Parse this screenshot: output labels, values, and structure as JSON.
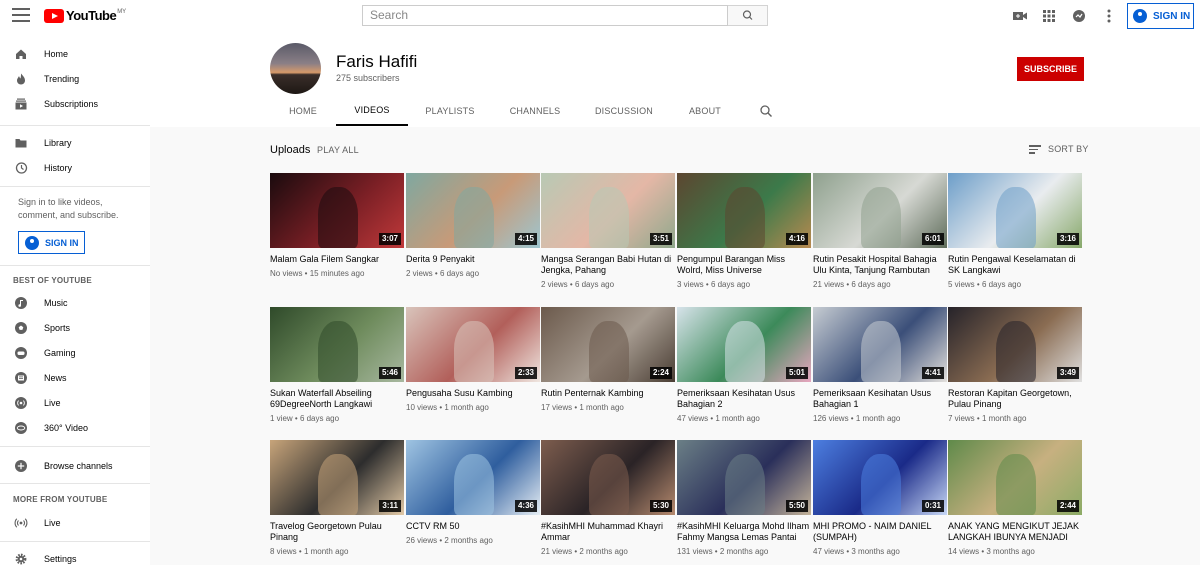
{
  "header": {
    "logo_text": "YouTube",
    "logo_country": "MY",
    "search_placeholder": "Search",
    "sign_in": "SIGN IN",
    "icons": [
      "menu-icon",
      "search-icon",
      "create-video-icon",
      "apps-icon",
      "messages-icon",
      "more-icon"
    ]
  },
  "sidebar": {
    "items_main": [
      {
        "label": "Home",
        "icon": "home-icon"
      },
      {
        "label": "Trending",
        "icon": "trending-icon"
      },
      {
        "label": "Subscriptions",
        "icon": "subscriptions-icon"
      }
    ],
    "items_library": [
      {
        "label": "Library",
        "icon": "library-icon"
      },
      {
        "label": "History",
        "icon": "history-icon"
      }
    ],
    "sign_in_text": "Sign in to like videos, comment, and subscribe.",
    "sign_in_button": "SIGN IN",
    "best_heading": "BEST OF YOUTUBE",
    "best_items": [
      {
        "label": "Music",
        "icon": "music-icon"
      },
      {
        "label": "Sports",
        "icon": "sports-icon"
      },
      {
        "label": "Gaming",
        "icon": "gaming-icon"
      },
      {
        "label": "News",
        "icon": "news-icon"
      },
      {
        "label": "Live",
        "icon": "live-icon"
      },
      {
        "label": "360° Video",
        "icon": "360-video-icon"
      }
    ],
    "browse_channels": "Browse channels",
    "more_heading": "MORE FROM YOUTUBE",
    "more_live": "Live",
    "settings": "Settings"
  },
  "channel": {
    "name": "Faris Hafifi",
    "subscribers": "275 subscribers",
    "subscribe_button": "SUBSCRIBE",
    "tabs": [
      "HOME",
      "VIDEOS",
      "PLAYLISTS",
      "CHANNELS",
      "DISCUSSION",
      "ABOUT"
    ],
    "active_tab": "VIDEOS"
  },
  "uploads": {
    "title": "Uploads",
    "play_all": "PLAY ALL",
    "sort_by": "SORT BY"
  },
  "videos": [
    {
      "title": "Malam Gala Filem Sangkar",
      "views": "No views",
      "age": "15 minutes ago",
      "duration": "3:07",
      "colors": [
        "#1a0b0e",
        "#7a1f25",
        "#c0393a"
      ]
    },
    {
      "title": "Derita 9 Penyakit",
      "views": "2 views",
      "age": "6 days ago",
      "duration": "4:15",
      "colors": [
        "#7fa8a0",
        "#c89a78",
        "#9dc6d0"
      ]
    },
    {
      "title": "Mangsa Serangan Babi Hutan di Jengka, Pahang",
      "views": "2 views",
      "age": "6 days ago",
      "duration": "3:51",
      "colors": [
        "#b8c9b4",
        "#e4b7a6",
        "#8fa88c"
      ]
    },
    {
      "title": "Pengumpul Barangan Miss Wolrd, Miss Universe",
      "views": "3 views",
      "age": "6 days ago",
      "duration": "4:16",
      "colors": [
        "#5c4630",
        "#3c7a4a",
        "#b98a50"
      ]
    },
    {
      "title": "Rutin Pesakit Hospital Bahagia Ulu Kinta, Tanjung Rambutan",
      "views": "21 views",
      "age": "6 days ago",
      "duration": "6:01",
      "colors": [
        "#8fa18e",
        "#d7d9d4",
        "#5e6c5a"
      ]
    },
    {
      "title": "Rutin Pengawal Keselamatan di SK Langkawi",
      "views": "5 views",
      "age": "6 days ago",
      "duration": "3:16",
      "colors": [
        "#6d9ec9",
        "#e9ecef",
        "#87a86a"
      ]
    },
    {
      "title": "Sukan Waterfall Abseiling 69DegreeNorth Langkawi",
      "views": "1 view",
      "age": "6 days ago",
      "duration": "5:46",
      "colors": [
        "#2f4a2a",
        "#6f8c5d",
        "#a8b8a0"
      ]
    },
    {
      "title": "Pengusaha Susu Kambing",
      "views": "10 views",
      "age": "1 month ago",
      "duration": "2:33",
      "colors": [
        "#d9c4bb",
        "#b25f5a",
        "#efe6e0"
      ]
    },
    {
      "title": "Rutin Penternak Kambing",
      "views": "17 views",
      "age": "1 month ago",
      "duration": "2:24",
      "colors": [
        "#6c5a4c",
        "#a59a8f",
        "#4a3e34"
      ]
    },
    {
      "title": "Pemeriksaan Kesihatan Usus Bahagian 2",
      "views": "47 views",
      "age": "1 month ago",
      "duration": "5:01",
      "colors": [
        "#d7e3ea",
        "#3c8a5a",
        "#e8a6bf"
      ]
    },
    {
      "title": "Pemeriksaan Kesihatan Usus Bahagian 1",
      "views": "126 views",
      "age": "1 month ago",
      "duration": "4:41",
      "colors": [
        "#c6ccd2",
        "#3b4f79",
        "#e3e0dc"
      ]
    },
    {
      "title": "Restoran Kapitan Georgetown, Pulau Pinang",
      "views": "7 views",
      "age": "1 month ago",
      "duration": "3:49",
      "colors": [
        "#26232a",
        "#8a6c52",
        "#e0e0e0"
      ]
    },
    {
      "title": "Travelog Georgetown Pulau Pinang",
      "views": "8 views",
      "age": "1 month ago",
      "duration": "3:11",
      "colors": [
        "#c7a47a",
        "#2d2d2d",
        "#e2c9a6"
      ]
    },
    {
      "title": "CCTV RM 50",
      "views": "26 views",
      "age": "2 months ago",
      "duration": "4:36",
      "colors": [
        "#9fc4e2",
        "#2f5e9e",
        "#e6eef4"
      ]
    },
    {
      "title": "#KasihMHI Muhammad Khayri Ammar",
      "views": "21 views",
      "age": "2 months ago",
      "duration": "5:30",
      "colors": [
        "#7d5d4e",
        "#2a2326",
        "#b68a6e"
      ]
    },
    {
      "title": "#KasihMHI Keluarga Mohd Ilham Fahmy Mangsa Lemas Pantai Tanjung Aru",
      "views": "131 views",
      "age": "2 months ago",
      "duration": "5:50",
      "colors": [
        "#6b7f86",
        "#2a2f5a",
        "#c5b49a"
      ]
    },
    {
      "title": "MHI PROMO - NAIM DANIEL (SUMPAH)",
      "views": "47 views",
      "age": "3 months ago",
      "duration": "0:31",
      "colors": [
        "#4d7fe0",
        "#1a2a88",
        "#c8d8f6"
      ]
    },
    {
      "title": "ANAK YANG MENGIKUT JEJAK LANGKAH IBUNYA MENJADI PENGUSAHA KEK",
      "views": "14 views",
      "age": "3 months ago",
      "duration": "2:44",
      "colors": [
        "#5f8a4a",
        "#c7b080",
        "#8cab66"
      ]
    }
  ]
}
